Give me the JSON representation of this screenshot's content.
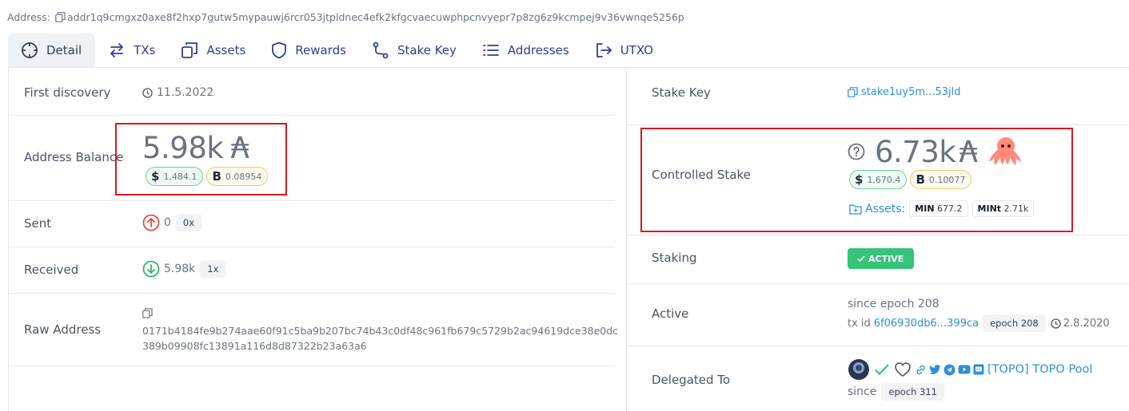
{
  "address": {
    "label": "Address:",
    "value": "addr1q9cmgxz0axe8f2hxp7gutw5mypauwj6rcr053jtpldnec4efk2kfgcvaecuwphpcnvyepr7p8zg6z9kcmpej9v36vwnqe5256p"
  },
  "tabs": [
    {
      "label": "Detail",
      "icon": "crosshair-icon"
    },
    {
      "label": "TXs",
      "icon": "swap-arrows-icon"
    },
    {
      "label": "Assets",
      "icon": "copy-squares-icon"
    },
    {
      "label": "Rewards",
      "icon": "shield-icon"
    },
    {
      "label": "Stake Key",
      "icon": "route-icon"
    },
    {
      "label": "Addresses",
      "icon": "list-icon"
    },
    {
      "label": "UTXO",
      "icon": "logout-arrow-icon"
    }
  ],
  "left": {
    "first_discovery": {
      "label": "First discovery",
      "value": "11.5.2022"
    },
    "balance": {
      "label": "Address Balance",
      "amount": "5.98k",
      "symbol": "₳",
      "usd": "1,484.1",
      "btc": "0.08954"
    },
    "sent": {
      "label": "Sent",
      "value": "0",
      "count": "0x"
    },
    "received": {
      "label": "Received",
      "value": "5.98k",
      "count": "1x"
    },
    "raw": {
      "label": "Raw Address",
      "line1": "0171b4184fe9b274aae60f91c5ba9b207bc74b43c0df48c961fb679c5729b2ac94619dce38e0dc",
      "line2": "389b09908fc13891a116d8d87322b23a63a6"
    }
  },
  "right": {
    "stake_key": {
      "label": "Stake Key",
      "value": "stake1uy5m...53jld"
    },
    "controlled": {
      "label": "Controlled Stake",
      "amount": "6.73k",
      "symbol": "₳",
      "usd": "1,670.4",
      "btc": "0.10077",
      "assets_label": "Assets:",
      "assets": [
        {
          "name": "MIN",
          "value": "677.2"
        },
        {
          "name": "MINt",
          "value": "2.71k"
        }
      ]
    },
    "staking": {
      "label": "Staking",
      "status": "ACTIVE"
    },
    "active": {
      "label": "Active",
      "since": "since epoch 208",
      "txid_label": "tx id",
      "txid": "6f06930db6...399ca",
      "epoch": "epoch 208",
      "date": "2.8.2020"
    },
    "delegated": {
      "label": "Delegated To",
      "pool": "[TOPO] TOPO Pool",
      "since": "since",
      "epoch": "epoch 311"
    }
  },
  "colors": {
    "accent": "#2f8fd8",
    "active_green": "#35c479",
    "sent_red": "#e5484d",
    "received_green": "#30b46c",
    "highlight_red": "#d71920"
  }
}
